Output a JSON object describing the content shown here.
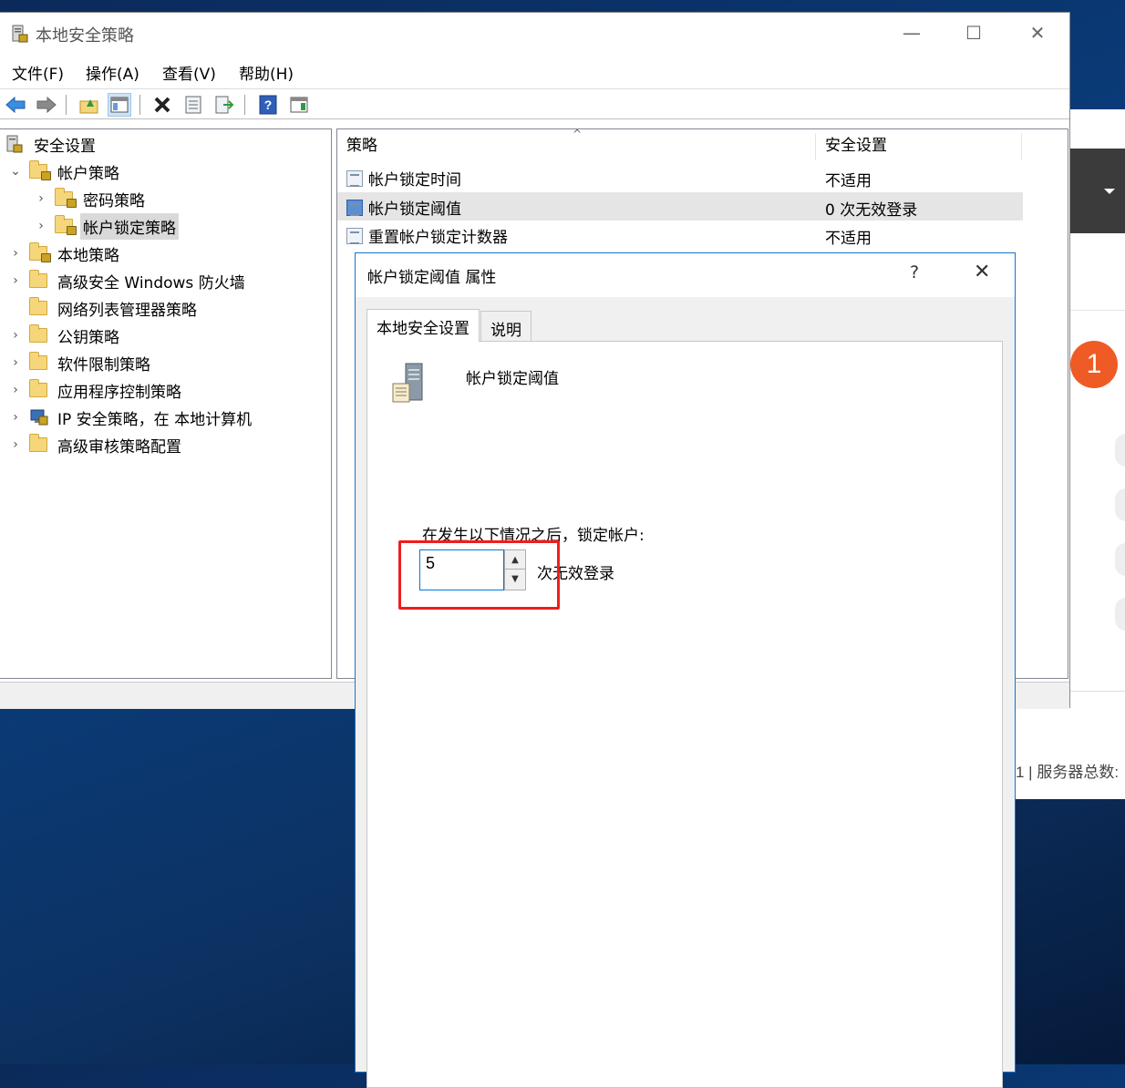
{
  "window": {
    "title": "本地安全策略",
    "minimize": "—",
    "maximize": "☐",
    "close": "✕"
  },
  "menu": [
    "文件(F)",
    "操作(A)",
    "查看(V)",
    "帮助(H)"
  ],
  "toolbar": {
    "icons": [
      "back-icon",
      "forward-icon",
      "up-folder-icon",
      "show-hide-tree-icon",
      "delete-icon",
      "properties-icon",
      "export-icon",
      "help-icon",
      "show-action-pane-icon"
    ]
  },
  "tree": {
    "root": "安全设置",
    "items": [
      {
        "label": "帐户策略",
        "expanded": true
      },
      {
        "label": "密码策略"
      },
      {
        "label": "帐户锁定策略",
        "selected": true
      },
      {
        "label": "本地策略"
      },
      {
        "label": "高级安全 Windows 防火墙"
      },
      {
        "label": "网络列表管理器策略"
      },
      {
        "label": "公钥策略"
      },
      {
        "label": "软件限制策略"
      },
      {
        "label": "应用程序控制策略"
      },
      {
        "label": "IP 安全策略，在 本地计算机"
      },
      {
        "label": "高级审核策略配置"
      }
    ]
  },
  "list": {
    "columns": [
      "策略",
      "安全设置"
    ],
    "rows": [
      {
        "policy": "帐户锁定时间",
        "setting": "不适用"
      },
      {
        "policy": "帐户锁定阈值",
        "setting": "0 次无效登录",
        "selected": true
      },
      {
        "policy": "重置帐户锁定计数器",
        "setting": "不适用"
      }
    ]
  },
  "dialog": {
    "title": "帐户锁定阈值 属性",
    "help": "?",
    "close": "✕",
    "tabs": [
      "本地安全设置",
      "说明"
    ],
    "policy_name": "帐户锁定阈值",
    "lock_label": "在发生以下情况之后，锁定帐户:",
    "value": "5",
    "unit_label": "次无效登录"
  },
  "background": {
    "badge": "1",
    "server_count_text": "1 | 服务器总数:"
  },
  "colors": {
    "highlight_box": "#f01d1d",
    "badge": "#ef5b25",
    "dialog_border": "#1a73c9"
  }
}
